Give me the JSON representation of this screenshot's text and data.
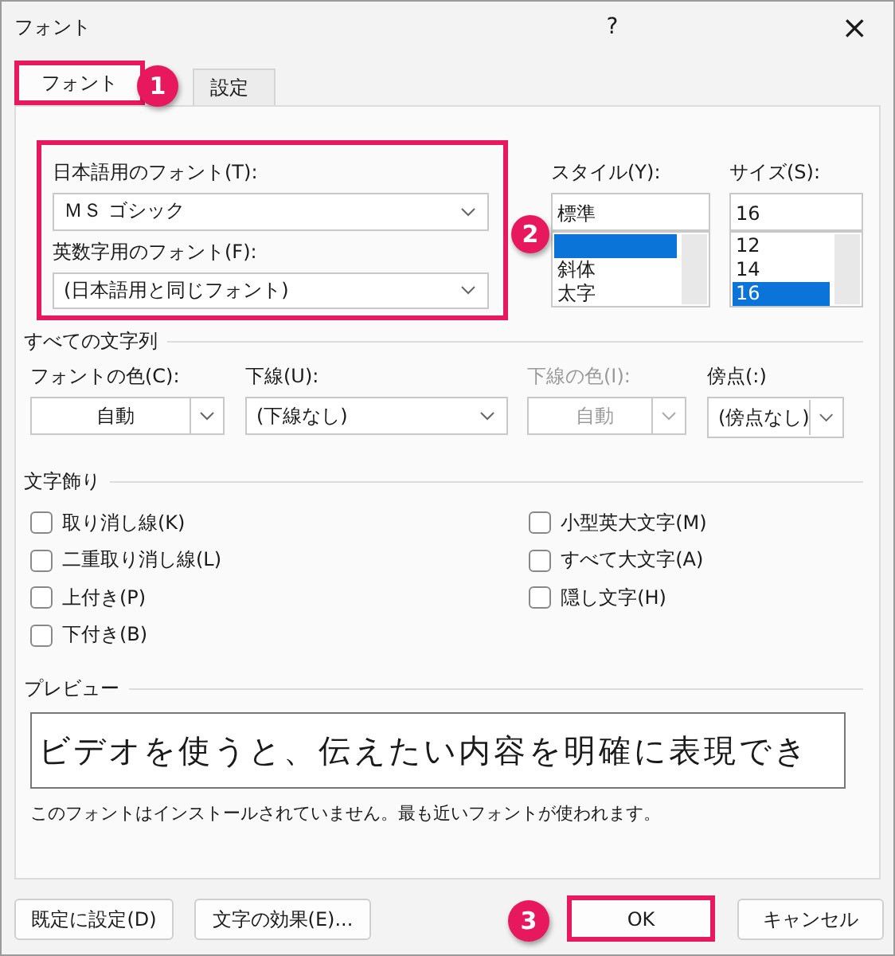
{
  "window": {
    "title": "フォント",
    "help": "?",
    "close": "×"
  },
  "tabs": [
    {
      "label": "フォント",
      "selected": true,
      "highlighted": true
    },
    {
      "label": "設定",
      "selected": false,
      "highlighted": false
    }
  ],
  "font_group": {
    "highlighted": true,
    "fields": [
      {
        "label": "日本語用のフォント(T):",
        "value": "ＭＳ ゴシック"
      },
      {
        "label": "英数字用のフォント(F):",
        "value": "(日本語用と同じフォント)"
      }
    ]
  },
  "style": {
    "label": "スタイル(Y):",
    "value": "標準",
    "items": [
      {
        "selected": true
      },
      {
        "label": "斜体",
        "selected": false
      },
      {
        "label": "太字",
        "selected": false
      }
    ]
  },
  "size": {
    "label": "サイズ(S):",
    "value": "16",
    "items": [
      {
        "label": "12",
        "selected": false
      },
      {
        "label": "14",
        "selected": false
      },
      {
        "label": "16",
        "selected": true
      }
    ]
  },
  "all_text": {
    "title": "すべての文字列",
    "combos": [
      {
        "label": "フォントの色(C):",
        "value": "自動",
        "disabled": false,
        "kind": "color"
      },
      {
        "label": "下線(U):",
        "value": "(下線なし)",
        "disabled": false,
        "kind": "list"
      },
      {
        "label": "下線の色(I):",
        "value": "自動",
        "disabled": true,
        "kind": "color"
      },
      {
        "label": "傍点(:)",
        "value": "(傍点なし)",
        "disabled": false,
        "kind": "split-list"
      }
    ]
  },
  "effects": {
    "title": "文字飾り",
    "left": [
      {
        "label": "取り消し線(K)",
        "checked": false
      },
      {
        "label": "二重取り消し線(L)",
        "checked": false
      },
      {
        "label": "上付き(P)",
        "checked": false
      },
      {
        "label": "下付き(B)",
        "checked": false
      }
    ],
    "right": [
      {
        "label": "小型英大文字(M)",
        "checked": false
      },
      {
        "label": "すべて大文字(A)",
        "checked": false
      },
      {
        "label": "隠し文字(H)",
        "checked": false
      }
    ]
  },
  "preview": {
    "title": "プレビュー",
    "sample": "ビデオを使うと、伝えたい内容を明確に表現でき",
    "note": "このフォントはインストールされていません。最も近いフォントが使われます。"
  },
  "buttons": [
    {
      "label": "既定に設定(D)",
      "highlighted": false
    },
    {
      "label": "文字の効果(E)...",
      "highlighted": false
    },
    {
      "label": "OK",
      "highlighted": true
    },
    {
      "label": "キャンセル",
      "highlighted": false
    }
  ],
  "callouts": [
    {
      "number": "1"
    },
    {
      "number": "2"
    },
    {
      "number": "3"
    }
  ]
}
